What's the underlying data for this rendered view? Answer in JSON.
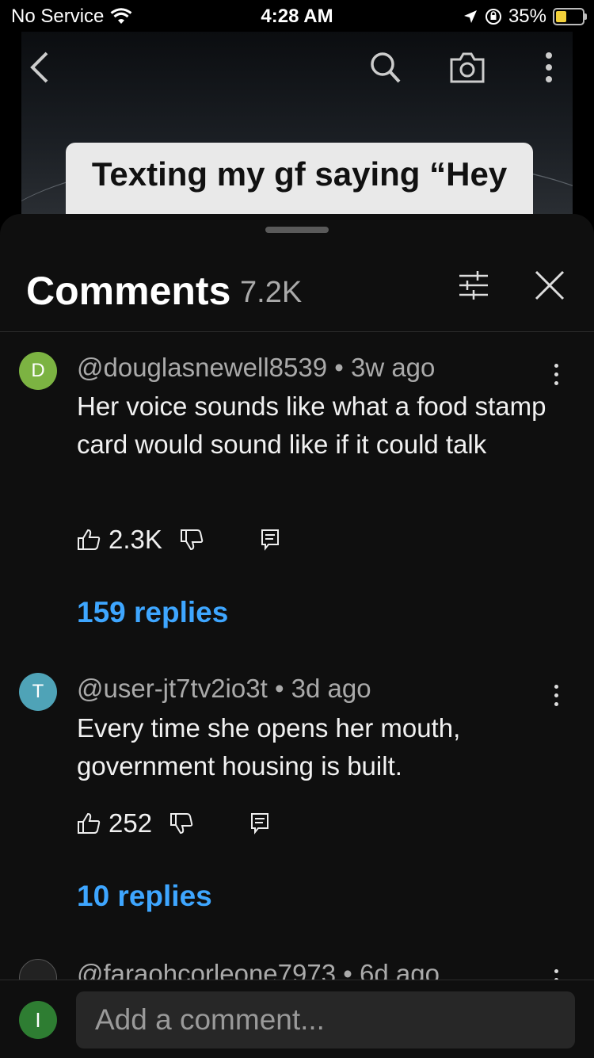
{
  "status_bar": {
    "carrier": "No Service",
    "time": "4:28 AM",
    "battery": "35%",
    "battery_level": 0.35,
    "battery_color": "#f3d13b"
  },
  "video": {
    "caption": "Texting my gf saying “Hey"
  },
  "comments_panel": {
    "title": "Comments",
    "count": "7.2K",
    "icons": [
      "sliders-icon",
      "close-icon"
    ]
  },
  "comments": [
    {
      "avatar_letter": "D",
      "avatar_color": "#7cb342",
      "author": "@douglasnewell8539",
      "age": "3w ago",
      "text": "Her voice sounds like what a food stamp card would sound like if it could talk",
      "likes": "2.3K",
      "replies": "159 replies"
    },
    {
      "avatar_letter": "T",
      "avatar_color": "#4fa3b7",
      "author": "@user-jt7tv2io3t",
      "age": "3d ago",
      "text": "Every time she opens her mouth, government housing is built.",
      "likes": "252",
      "replies": "10 replies"
    },
    {
      "author": "@faraohcorleone7973",
      "age": "6d ago"
    }
  ],
  "composer": {
    "avatar_letter": "I",
    "placeholder": "Add a comment..."
  },
  "accent_color": "#3ea6ff"
}
